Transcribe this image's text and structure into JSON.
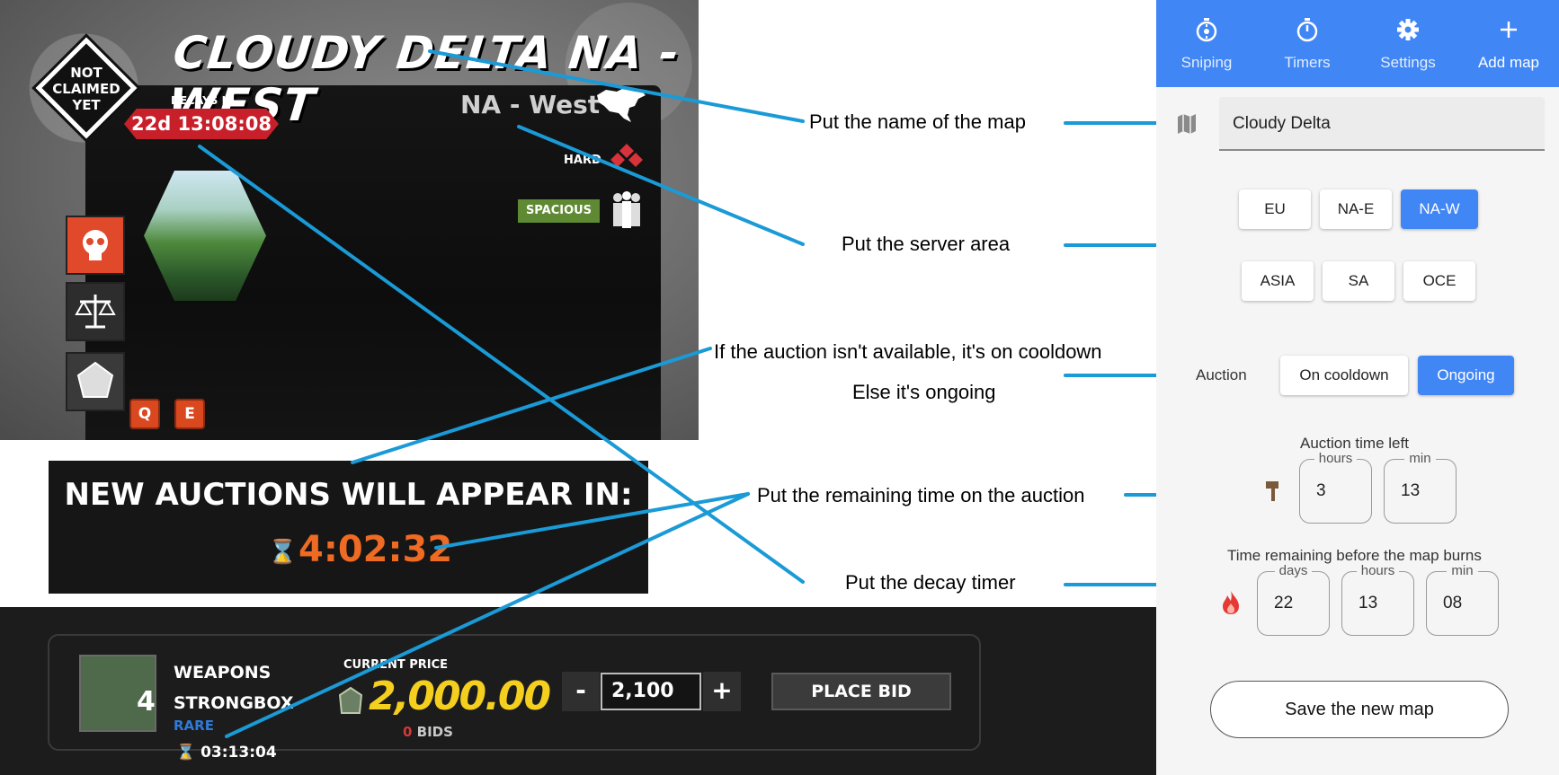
{
  "game": {
    "claim_badge_lines": [
      "NOT",
      "CLAIMED",
      "YET"
    ],
    "map_title": "CLOUDY DELTA NA - WEST",
    "decays_label": "DECAYS IN",
    "decays_value": "22d 13:08:08",
    "region": "NA - West",
    "difficulty": "HARD",
    "size_badge": "SPACIOUS",
    "keys": [
      "Q",
      "E"
    ]
  },
  "banner": {
    "title": "NEW AUCTIONS WILL APPEAR IN:",
    "countdown": "4:02:32"
  },
  "bid": {
    "item_count": "4",
    "item_name_1": "WEAPONS",
    "item_name_2": "STRONGBOX",
    "rarity": "RARE",
    "timer": "03:13:04",
    "price_label": "CURRENT PRICE",
    "price": "2,000.00",
    "bids_count": "0",
    "bids_label": "BIDS",
    "minus": "-",
    "plus": "+",
    "bid_value": "2,100",
    "place_bid": "PLACE BID"
  },
  "annotations": {
    "map_name": "Put the name of the map",
    "server_area": "Put the server area",
    "cooldown_1": "If the auction isn't available, it's on cooldown",
    "cooldown_2": "Else it's ongoing",
    "remaining": "Put the remaining time on the auction",
    "decay": "Put the decay timer"
  },
  "app": {
    "nav": [
      {
        "label": "Sniping",
        "icon": "stopwatch-crosshair-icon"
      },
      {
        "label": "Timers",
        "icon": "timer-icon"
      },
      {
        "label": "Settings",
        "icon": "gear-icon"
      },
      {
        "label": "Add map",
        "icon": "plus-icon"
      }
    ],
    "map_name_value": "Cloudy Delta",
    "regions_row1": [
      "EU",
      "NA-E",
      "NA-W"
    ],
    "regions_row2": [
      "ASIA",
      "SA",
      "OCE"
    ],
    "selected_region": "NA-W",
    "auction_label": "Auction",
    "auction_states": [
      "On cooldown",
      "Ongoing"
    ],
    "selected_auction_state": "Ongoing",
    "auction_time_label": "Auction time left",
    "auction_hours_label": "hours",
    "auction_hours_value": "3",
    "auction_min_label": "min",
    "auction_min_value": "13",
    "burn_label": "Time remaining before the map burns",
    "burn_days_label": "days",
    "burn_days_value": "22",
    "burn_hours_label": "hours",
    "burn_hours_value": "13",
    "burn_min_label": "min",
    "burn_min_value": "08",
    "save_label": "Save the new map",
    "colors": {
      "accent": "#4186f5",
      "connector": "#1a9ad6",
      "price": "#f4cf1e",
      "countdown": "#ef6a23"
    }
  }
}
